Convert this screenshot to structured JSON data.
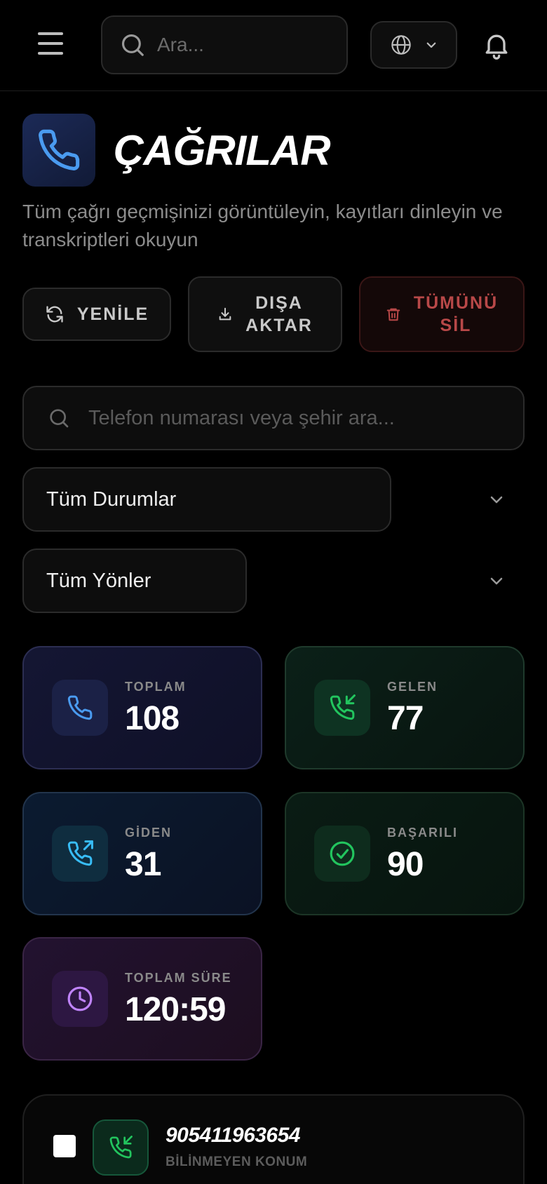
{
  "topbar": {
    "search_placeholder": "Ara...",
    "icons": [
      "menu-icon",
      "search-icon",
      "globe-icon",
      "chevron-down-icon",
      "bell-icon"
    ]
  },
  "header": {
    "title": "ÇAĞRILAR",
    "subtitle": "Tüm çağrı geçmişinizi görüntüleyin, kayıtları dinleyin ve transkriptleri okuyun"
  },
  "actions": {
    "refresh_label": "YENİLE",
    "export_label_1": "DIŞA",
    "export_label_2": "AKTAR",
    "delete_label_1": "TÜMÜNÜ",
    "delete_label_2": "SİL"
  },
  "filters": {
    "search_placeholder": "Telefon numarası veya şehir ara...",
    "status_value": "Tüm Durumlar",
    "direction_value": "Tüm Yönler"
  },
  "stats": {
    "total": {
      "label": "TOPLAM",
      "value": "108"
    },
    "incoming": {
      "label": "GELEN",
      "value": "77"
    },
    "outgoing": {
      "label": "GİDEN",
      "value": "31"
    },
    "success": {
      "label": "BAŞARILI",
      "value": "90"
    },
    "duration": {
      "label": "TOPLAM SÜRE",
      "value": "120:59"
    }
  },
  "calls": [
    {
      "number": "905411963654",
      "location": "BİLİNMEYEN KONUM",
      "direction": "incoming"
    }
  ],
  "colors": {
    "background": "#000000",
    "blue_accent": "#4a9bf0",
    "green_accent": "#22c55e",
    "cyan_accent": "#38bdf8",
    "purple_accent": "#c084fc",
    "danger": "#b84848"
  }
}
